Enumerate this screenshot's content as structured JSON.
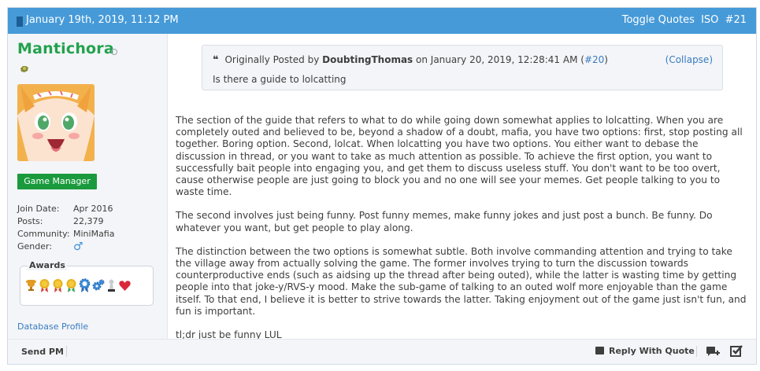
{
  "header": {
    "date": "January 19th, 2019, 11:12 PM",
    "toggle_quotes": "Toggle Quotes",
    "iso": "ISO",
    "post_number": "#21"
  },
  "user": {
    "name": "Mantichora",
    "usergroup": "Game Manager",
    "info": [
      {
        "key": "Join Date:",
        "value": "Apr 2016"
      },
      {
        "key": "Posts:",
        "value": "22,379"
      },
      {
        "key": "Community:",
        "value": "MiniMafia"
      },
      {
        "key": "Gender:",
        "value": "♂"
      }
    ],
    "awards_label": "Awards",
    "database_profile": "Database Profile"
  },
  "quote": {
    "prefix": "Originally Posted by",
    "author": "DoubtingThomas",
    "on": "on January 20, 2019, 12:28:41 AM (",
    "post_ref": "#20",
    "close_paren": ")",
    "collapse": "(Collapse)",
    "text": "Is there a guide to lolcatting"
  },
  "body": {
    "paragraphs": [
      "The section of the guide that refers to what to do while going down somewhat applies to lolcatting. When you are completely outed and believed to be, beyond a shadow of a doubt, mafia, you have two options: first, stop posting all together. Boring option. Second, lolcat. When lolcatting you have two options. You either want to debase the discussion in thread, or you want to take as much attention as possible. To achieve the first option, you want to successfully bait people into engaging you, and get them to discuss useless stuff. You don't want to be too overt, cause otherwise people are just going to block you and no one will see your memes. Get people talking to you to waste time.",
      "The second involves just being funny. Post funny memes, make funny jokes and just post a bunch. Be funny. Do whatever you want, but get people to play along.",
      "The distinction between the two options is somewhat subtle. Both involve commanding attention and trying to take the village away from actually solving the game. The former involves trying to turn the discussion towards counterproductive ends (such as aidsing up the thread after being outed), while the latter is wasting time by getting people into that joke-y/RVS-y mood. Make the sub-game of talking to an outed wolf more enjoyable than the game itself. To that end, I believe it is better to strive towards the latter. Taking enjoyment out of the game just isn't fun, and fun is important.",
      "tl;dr just be funny LUL"
    ]
  },
  "footer": {
    "send_pm": "Send PM",
    "reply_with_quote": "Reply With Quote"
  },
  "colors": {
    "header_bg": "#469ad8",
    "username": "#23a24d",
    "usergroup_bg": "#1a9a3d",
    "link": "#3a7bc0"
  }
}
